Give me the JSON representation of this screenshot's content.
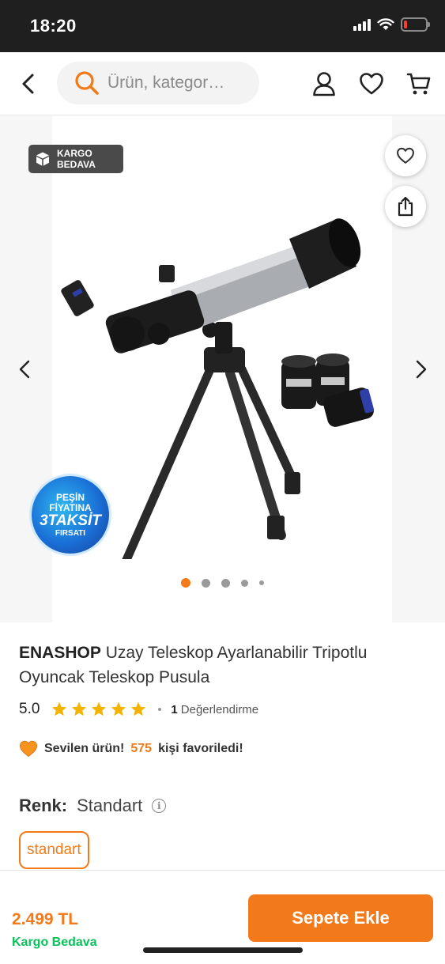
{
  "status_bar": {
    "time": "18:20",
    "battery_level": 0.15
  },
  "header": {
    "search_placeholder": "Ürün, kategor…",
    "icons": [
      "back-icon",
      "search-icon",
      "user-icon",
      "heart-icon",
      "cart-icon"
    ]
  },
  "gallery": {
    "cargo_badge": {
      "line1": "KARGO",
      "line2": "BEDAVA"
    },
    "promo_badge": {
      "line1": "PEŞİN",
      "line2": "FİYATINA",
      "line3": "3TAKSİT",
      "line4": "FIRSATI"
    },
    "image_count": 5,
    "active_index": 0
  },
  "product": {
    "brand": "ENASHOP",
    "name": " Uzay Teleskop Ayarlanabilir Tripotlu Oyuncak Teleskop Pusula",
    "rating": "5.0",
    "stars": 5,
    "review_count": "1",
    "review_label": "Değerlendirme",
    "favorite_prefix": "Sevilen ürün!",
    "favorite_count": "575",
    "favorite_suffix": "kişi favoriledi!",
    "color_label": "Renk:",
    "color_value": "Standart",
    "variant": "standart"
  },
  "bottom_bar": {
    "price": "2.499 TL",
    "shipping": "Kargo Bedava",
    "add_to_cart": "Sepete Ekle"
  },
  "colors": {
    "accent": "#f27a1a",
    "success": "#0bc15c",
    "star": "#f5b301",
    "status_bar_bg": "#1f1f1f"
  }
}
